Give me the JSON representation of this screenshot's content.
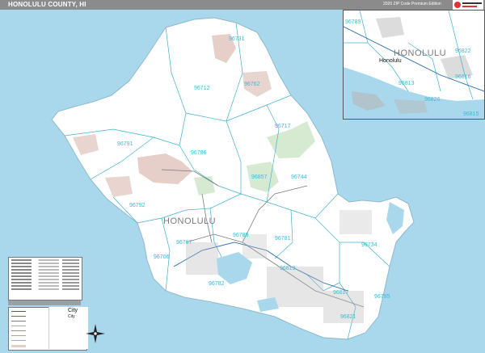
{
  "header": {
    "title": "HONOLULU COUNTY, HI",
    "edition": "2020 ZIP Code Premium Edition"
  },
  "labels": {
    "county_big": "HONOLULU",
    "inset_big": "HONOLULU",
    "inset_city": "Honolulu"
  },
  "zip_labels": [
    "96731",
    "96712",
    "96762",
    "96717",
    "96791",
    "96786",
    "96857",
    "96744",
    "96792",
    "96707",
    "96789",
    "96781",
    "96734",
    "96706",
    "96782",
    "96819",
    "96795",
    "96817",
    "96821",
    "96813",
    "96822",
    "96816",
    "96826",
    "96815"
  ],
  "legend": {
    "city_big": "City",
    "city_small": "City"
  },
  "colors": {
    "water": "#a9d8ec",
    "land": "#ffffff",
    "park": "#d6ead1",
    "military": "#e8d5cf",
    "zip_label": "#3fb9d6",
    "boundary": "#3fb0cf",
    "road": "#7a7a7a"
  }
}
